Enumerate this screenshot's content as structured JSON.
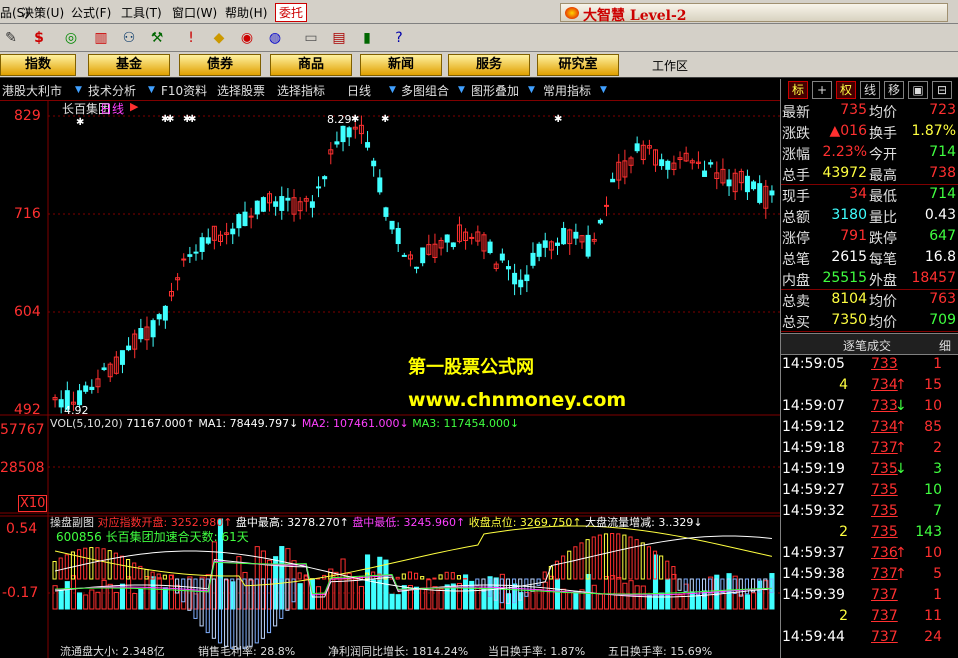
{
  "menu": {
    "items": [
      "品(S)",
      "决策(U)",
      "公式(F)",
      "工具(T)",
      "窗口(W)",
      "帮助(H)"
    ],
    "active": "委托"
  },
  "brand": {
    "text": "大智慧 Level-2"
  },
  "nav": {
    "buttons": [
      "指数",
      "基金",
      "债券",
      "商品",
      "新闻",
      "服务",
      "研究室"
    ],
    "workarea": "工作区"
  },
  "subbar": [
    "港股大利市",
    "技术分析",
    "F10资料",
    "选择股票",
    "选择指标",
    "日线",
    "多图组合",
    "图形叠加",
    "常用指标"
  ],
  "right_tabs": [
    "标",
    "+",
    "权",
    "线",
    "移",
    "",
    "",
    "细"
  ],
  "chart_header": {
    "name": "长百集团",
    "period": "日线"
  },
  "price_axis": [
    "829",
    "716",
    "604",
    "492"
  ],
  "price_annotations": {
    "high": "8.29",
    "low": "4.92"
  },
  "vol_axis": [
    "57767",
    "28508",
    "X10"
  ],
  "vol_header": {
    "label": "VOL(5,10,20)",
    "vol": "71167.000↑",
    "ma1": "MA1: 78449.797↓",
    "ma2": "MA2: 107461.000↓",
    "ma3": "MA3: 117454.000↓"
  },
  "sub_header": {
    "title": "操盘副图",
    "f1": "对应指数开盘: 3252.980↑",
    "f2": "盘中最高: 3278.270↑",
    "f3": "盘中最低: 3245.960↑",
    "f4": "收盘点位: 3269.750↑",
    "f5": "大盘流量增减: 3..329↓",
    "line2": "600856 长百集团加速合天数: 61天"
  },
  "sub_axis": [
    "0.54",
    "-0.17"
  ],
  "watermark": {
    "line1": "第一股票公式网",
    "line2": "www.chnmoney.com"
  },
  "info": [
    {
      "k": "最新",
      "v": "735",
      "c": "up",
      "k2": "均价",
      "v2": "723",
      "c2": "up"
    },
    {
      "k": "涨跌",
      "v": "▲016",
      "c": "up",
      "k2": "换手",
      "v2": "1.87%",
      "c2": "yl"
    },
    {
      "k": "涨幅",
      "v": "2.23%",
      "c": "up",
      "k2": "今开",
      "v2": "714",
      "c2": "dn"
    },
    {
      "k": "总手",
      "v": "43972",
      "c": "yl",
      "k2": "最高",
      "v2": "738",
      "c2": "up"
    },
    {
      "k": "现手",
      "v": "34",
      "c": "up",
      "k2": "最低",
      "v2": "714",
      "c2": "dn"
    },
    {
      "k": "总额",
      "v": "3180",
      "c": "cy",
      "k2": "量比",
      "v2": "0.43",
      "c2": "wh"
    },
    {
      "k": "涨停",
      "v": "791",
      "c": "up",
      "k2": "跌停",
      "v2": "647",
      "c2": "dn"
    },
    {
      "k": "总笔",
      "v": "2615",
      "c": "wh",
      "k2": "每笔",
      "v2": "16.8",
      "c2": "wh"
    },
    {
      "k": "内盘",
      "v": "25515",
      "c": "dn",
      "k2": "外盘",
      "v2": "18457",
      "c2": "up"
    },
    {
      "k": "总卖",
      "v": "8104",
      "c": "yl",
      "k2": "均价",
      "v2": "763",
      "c2": "up"
    },
    {
      "k": "总买",
      "v": "7350",
      "c": "yl",
      "k2": "均价",
      "v2": "709",
      "c2": "dn"
    }
  ],
  "ticks_head": "逐笔成交",
  "ticks": [
    {
      "t": "14:59:05",
      "p": "733",
      "a": "",
      "v": "1",
      "pc": "up",
      "vc": "up"
    },
    {
      "t": "4",
      "p": "734",
      "a": "↑",
      "v": "15",
      "pc": "up",
      "vc": "up"
    },
    {
      "t": "14:59:07",
      "p": "733",
      "a": "↓",
      "v": "10",
      "pc": "up",
      "vc": "up"
    },
    {
      "t": "14:59:12",
      "p": "734",
      "a": "↑",
      "v": "85",
      "pc": "up",
      "vc": "up"
    },
    {
      "t": "14:59:18",
      "p": "737",
      "a": "↑",
      "v": "2",
      "pc": "up",
      "vc": "up"
    },
    {
      "t": "14:59:19",
      "p": "735",
      "a": "↓",
      "v": "3",
      "pc": "up",
      "vc": "dn"
    },
    {
      "t": "14:59:27",
      "p": "735",
      "a": "",
      "v": "10",
      "pc": "up",
      "vc": "dn"
    },
    {
      "t": "14:59:32",
      "p": "735",
      "a": "",
      "v": "7",
      "pc": "up",
      "vc": "dn"
    },
    {
      "t": "2",
      "p": "735",
      "a": "",
      "v": "143",
      "pc": "up",
      "vc": "dn"
    },
    {
      "t": "14:59:37",
      "p": "736",
      "a": "↑",
      "v": "10",
      "pc": "up",
      "vc": "up"
    },
    {
      "t": "14:59:38",
      "p": "737",
      "a": "↑",
      "v": "5",
      "pc": "up",
      "vc": "up"
    },
    {
      "t": "14:59:39",
      "p": "737",
      "a": "",
      "v": "1",
      "pc": "up",
      "vc": "up"
    },
    {
      "t": "2",
      "p": "737",
      "a": "",
      "v": "11",
      "pc": "up",
      "vc": "up"
    },
    {
      "t": "14:59:44",
      "p": "737",
      "a": "",
      "v": "24",
      "pc": "up",
      "vc": "up"
    }
  ],
  "status": {
    "s1": "流通盘大小: 2.348亿",
    "s2": "销售毛利率: 28.8%",
    "s3": "净利润同比增长: 1814.24%",
    "s4": "当日换手率: 1.87%",
    "s5": "五日换手率: 15.69%"
  },
  "colors": {
    "up": "#ff3030",
    "down": "#40ffff",
    "ma1": "#ffffff",
    "ma2": "#ffff40",
    "ma3": "#ff40ff",
    "grid": "#800000"
  }
}
